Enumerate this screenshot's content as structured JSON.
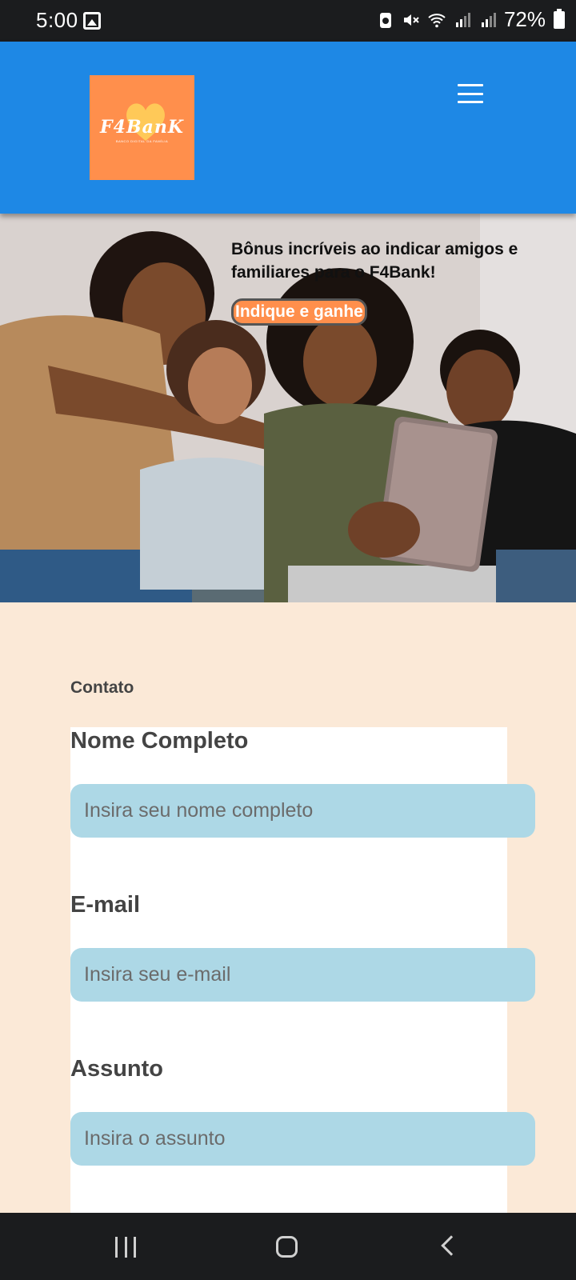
{
  "status_bar": {
    "time": "5:00",
    "battery": "72%",
    "icons": [
      "image-icon",
      "recycle-icon",
      "mute-icon",
      "wifi-icon",
      "signal-icon",
      "signal-icon",
      "battery-icon"
    ]
  },
  "header": {
    "logo_text": "F4BanK",
    "logo_subtitle": "BANCO DIGITAL DA FAMÍLIA",
    "menu_icon": "hamburger-menu-icon",
    "brand_color": "#1e88e5",
    "logo_color": "#ff8f4c"
  },
  "hero": {
    "headline": "Bônus incríveis ao indicar amigos e familiares para o F4Bank!",
    "cta_label": "Indique e ganhe"
  },
  "contact": {
    "section_label": "Contato",
    "fields": [
      {
        "label": "Nome Completo",
        "placeholder": "Insira seu nome completo"
      },
      {
        "label": "E-mail",
        "placeholder": "Insira seu e-mail"
      },
      {
        "label": "Assunto",
        "placeholder": "Insira o assunto"
      }
    ],
    "input_color": "#add8e6"
  },
  "nav_bar": {
    "icons": [
      "recent-apps-icon",
      "home-icon",
      "back-icon"
    ]
  }
}
